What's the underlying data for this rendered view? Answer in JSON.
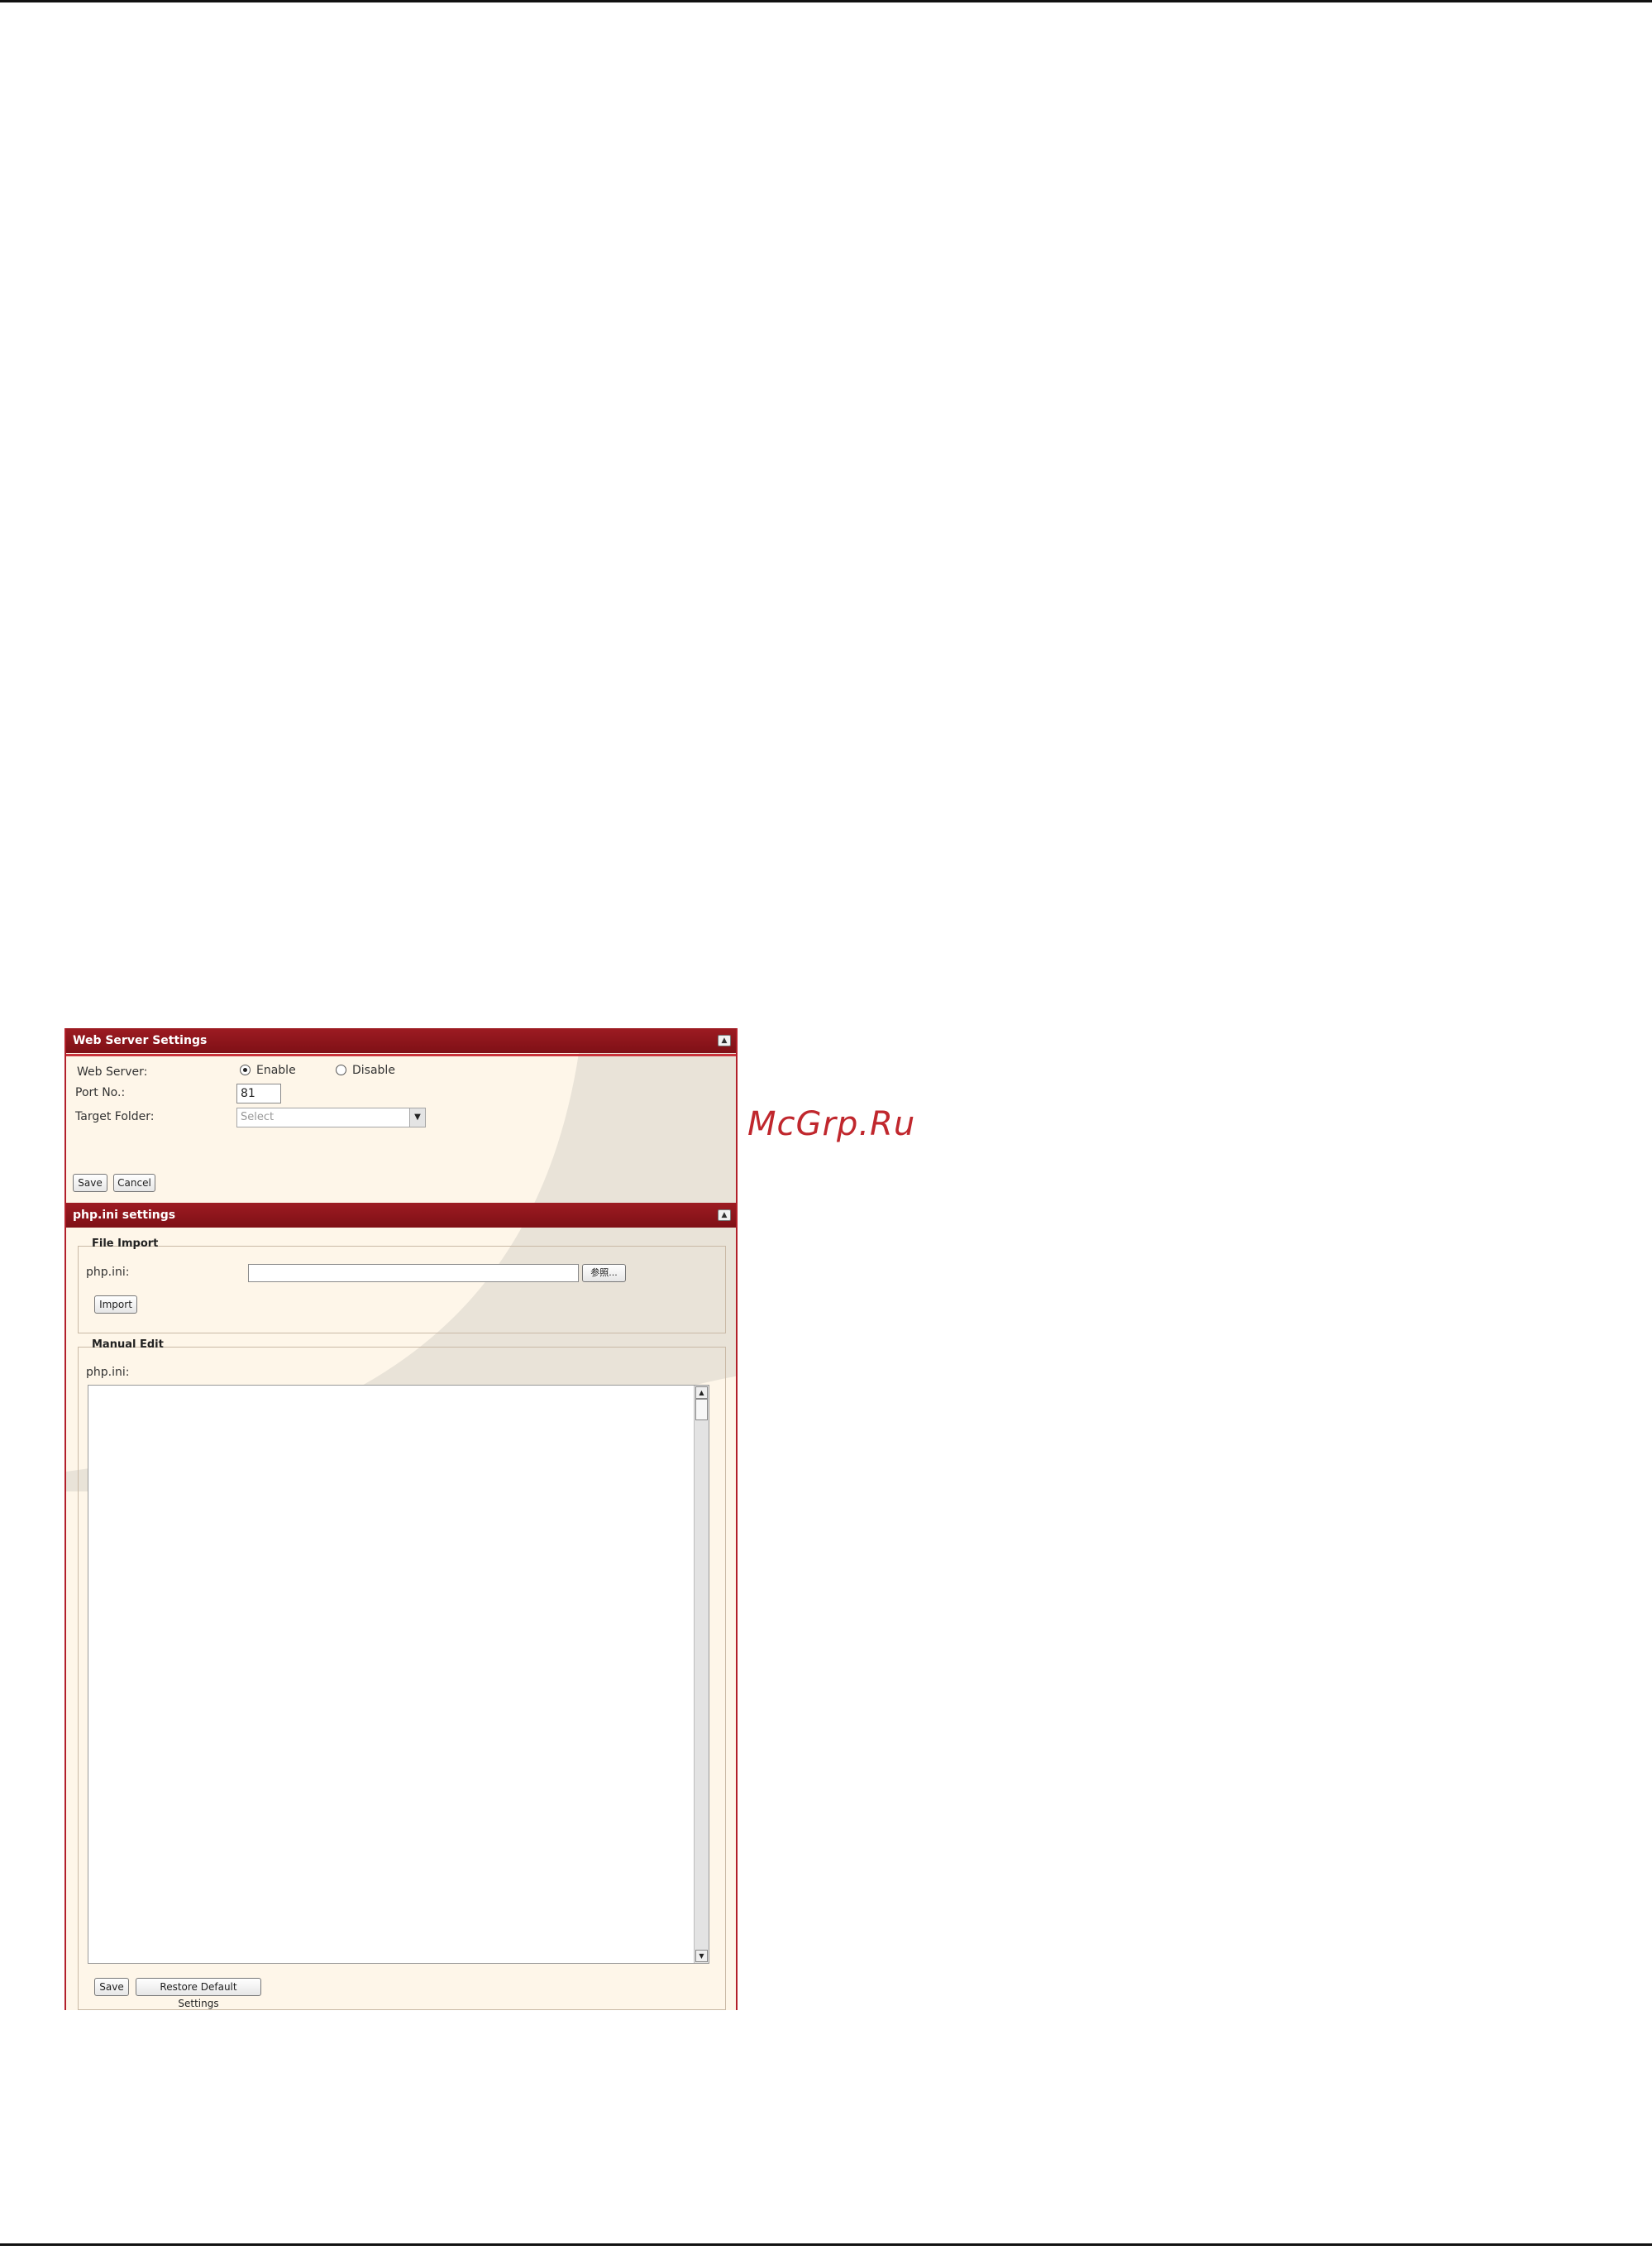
{
  "watermark": "McGrp.Ru",
  "web_server_settings": {
    "title": "Web Server Settings",
    "web_server_label": "Web Server:",
    "enable_label": "Enable",
    "disable_label": "Disable",
    "enabled": true,
    "port_label": "Port No.:",
    "port_value": "81",
    "target_folder_label": "Target Folder:",
    "target_folder_value": "Select",
    "save_label": "Save",
    "cancel_label": "Cancel"
  },
  "php_ini_settings": {
    "title": "php.ini settings",
    "file_import": {
      "legend": "File Import",
      "field_label": "php.ini:",
      "browse_label": "参照...",
      "import_label": "Import"
    },
    "manual_edit": {
      "legend": "Manual Edit",
      "field_label": "php.ini:",
      "content": "",
      "save_label": "Save",
      "restore_label": "Restore Default Settings"
    }
  },
  "colors": {
    "header": "#8b141b",
    "panel_background": "#fef6e9",
    "swoosh": "#e9e3d8",
    "watermark": "#c0272d"
  }
}
